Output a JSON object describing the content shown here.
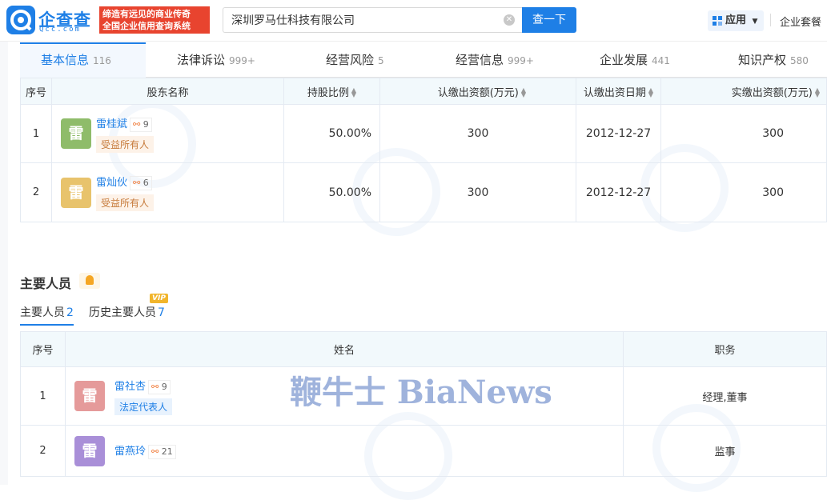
{
  "brand": {
    "name": "企查查",
    "sub": "Qcc.com",
    "slogan_line1": "缔造有远见的商业传奇",
    "slogan_line2": "全国企业信用查询系统"
  },
  "search": {
    "value": "深圳罗马仕科技有限公司",
    "button": "查一下"
  },
  "header": {
    "apps_label": "应用",
    "package_label": "企业套餐"
  },
  "tabs": [
    {
      "label": "基本信息",
      "count": "116"
    },
    {
      "label": "法律诉讼",
      "count": "999+"
    },
    {
      "label": "经营风险",
      "count": "5"
    },
    {
      "label": "经营信息",
      "count": "999+"
    },
    {
      "label": "企业发展",
      "count": "441"
    },
    {
      "label": "知识产权",
      "count": "580"
    }
  ],
  "shareholders": {
    "headers": [
      "序号",
      "股东名称",
      "持股比例",
      "认缴出资额(万元)",
      "认缴出资日期",
      "实缴出资额(万元)"
    ],
    "rows": [
      {
        "no": "1",
        "avatar": "雷",
        "avatar_color": "#8fbc6a",
        "name": "雷桂斌",
        "links": "9",
        "tag": "受益所有人",
        "ratio": "50.00%",
        "subscribed": "300",
        "date": "2012-12-27",
        "paid": "300"
      },
      {
        "no": "2",
        "avatar": "雷",
        "avatar_color": "#e8c36c",
        "name": "雷灿伙",
        "links": "6",
        "tag": "受益所有人",
        "ratio": "50.00%",
        "subscribed": "300",
        "date": "2012-12-27",
        "paid": "300"
      }
    ]
  },
  "personnel": {
    "title": "主要人员",
    "subtabs": [
      {
        "label": "主要人员",
        "count": "2"
      },
      {
        "label": "历史主要人员",
        "count": "7"
      }
    ],
    "vip": "VIP",
    "headers": [
      "序号",
      "姓名",
      "职务"
    ],
    "rows": [
      {
        "no": "1",
        "avatar": "雷",
        "avatar_color": "#e59a9a",
        "name": "雷社杏",
        "links": "9",
        "tag": "法定代表人",
        "position": "经理,董事"
      },
      {
        "no": "2",
        "avatar": "雷",
        "avatar_color": "#a98fd8",
        "name": "雷燕玲",
        "links": "21",
        "tag": "",
        "position": "监事"
      }
    ]
  },
  "watermark": "鞭牛士 BiaNews"
}
